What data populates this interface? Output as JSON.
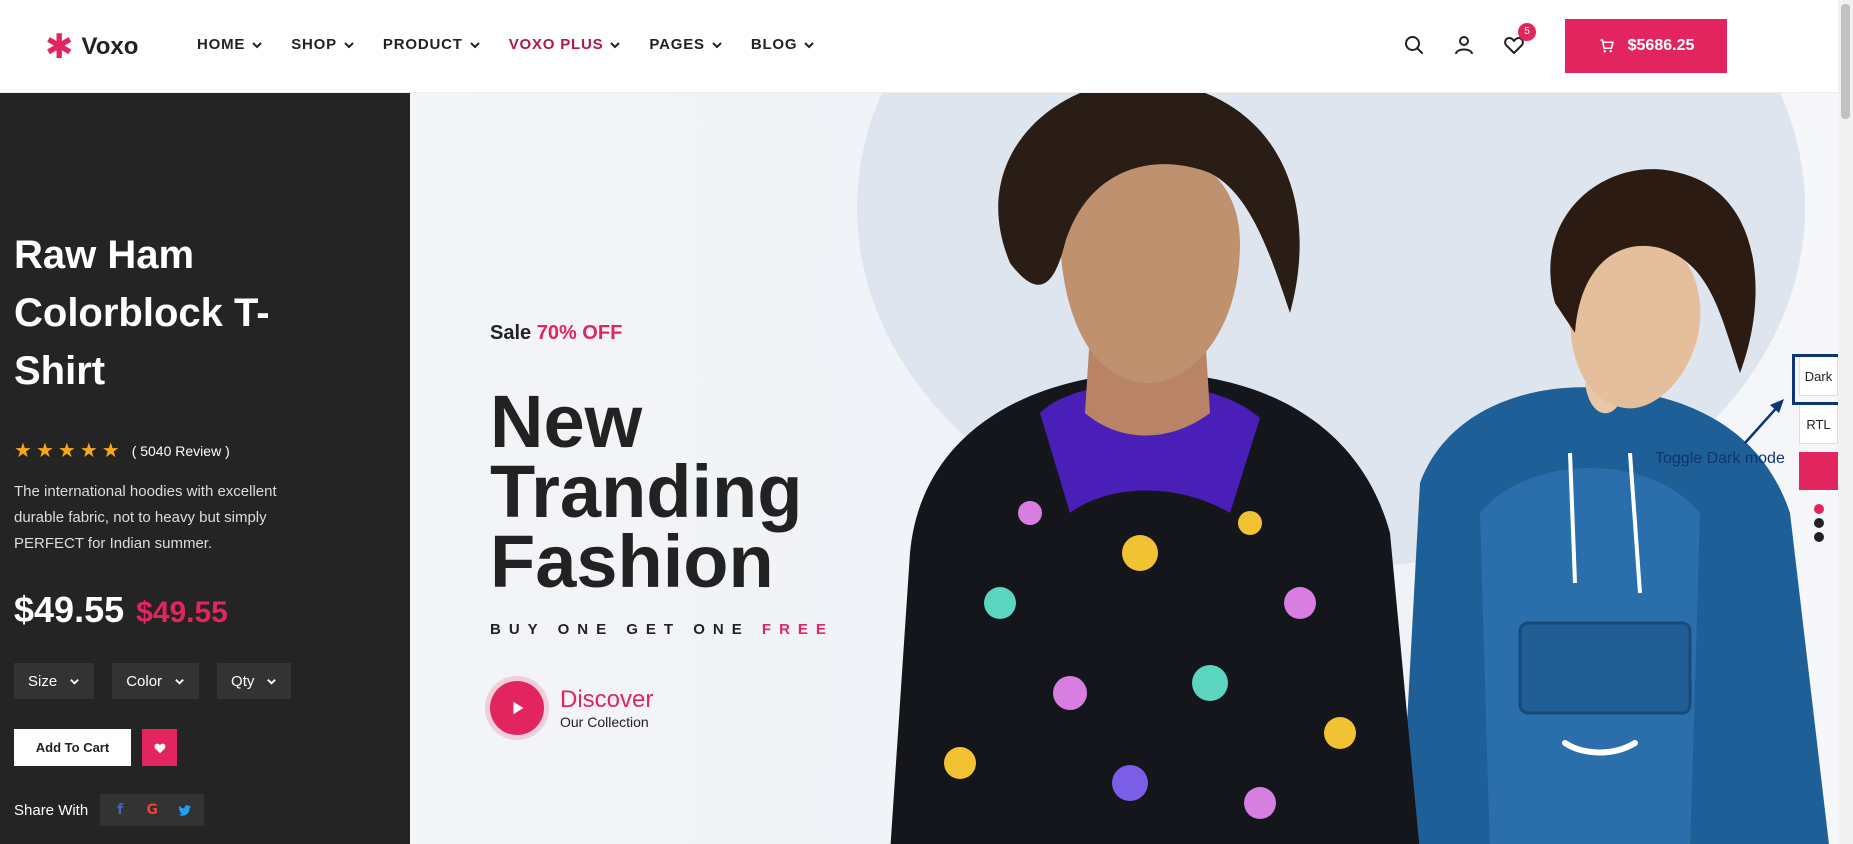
{
  "brand": {
    "logo_text": "Voxo",
    "accent": "#e2255f"
  },
  "nav": {
    "items": [
      {
        "label": "HOME"
      },
      {
        "label": "SHOP"
      },
      {
        "label": "PRODUCT"
      },
      {
        "label": "VOXO PLUS"
      },
      {
        "label": "PAGES"
      },
      {
        "label": "BLOG"
      }
    ]
  },
  "header": {
    "wishlist_count": "5",
    "cart_total": "$5686.25",
    "icons": [
      "search-icon",
      "user-icon",
      "heart-icon",
      "cart-icon"
    ]
  },
  "product": {
    "title": "Raw Ham Colorblock T-Shirt",
    "rating_stars": 5,
    "review_text": "( 5040 Review )",
    "description": "The international hoodies with excellent durable fabric, not to heavy but simply PERFECT for Indian summer.",
    "price": "$49.55",
    "sale_price": "$49.55",
    "selects": {
      "size": "Size",
      "color": "Color",
      "qty": "Qty"
    },
    "add_to_cart": "Add To Cart",
    "share_label": "Share With"
  },
  "hero": {
    "sale_prefix": "Sale",
    "sale_off": "70% OFF",
    "title": "New Tranding Fashion",
    "bogo_prefix": "BUY ONE GET ONE",
    "bogo_free": "FREE",
    "discover_title": "Discover",
    "discover_sub": "Our Collection"
  },
  "switcher": {
    "dark_label": "Dark",
    "rtl_label": "RTL",
    "annotation": "Toggle Dark mode",
    "dot_colors": [
      "#e2255f",
      "#222222",
      "#222222"
    ]
  }
}
